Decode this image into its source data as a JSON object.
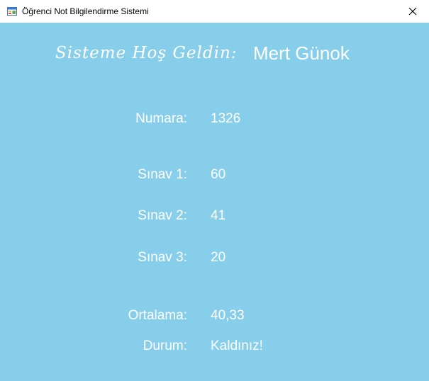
{
  "window": {
    "title": "Öğrenci Not Bilgilendirme Sistemi",
    "icon": "windows-form-icon",
    "close_icon": "close-icon"
  },
  "header": {
    "welcome": "Sisteme Hoş Geldin:",
    "student_name": "Mert Günok"
  },
  "fields": {
    "numara_label": "Numara:",
    "numara_value": "1326",
    "sinav1_label": "Sınav 1:",
    "sinav1_value": "60",
    "sinav2_label": "Sınav 2:",
    "sinav2_value": "41",
    "sinav3_label": "Sınav 3:",
    "sinav3_value": "20",
    "ortalama_label": "Ortalama:",
    "ortalama_value": "40,33",
    "durum_label": "Durum:",
    "durum_value": "Kaldınız!"
  },
  "colors": {
    "background": "#87ceeb",
    "text": "#ffffff",
    "titlebar": "#ffffff"
  }
}
